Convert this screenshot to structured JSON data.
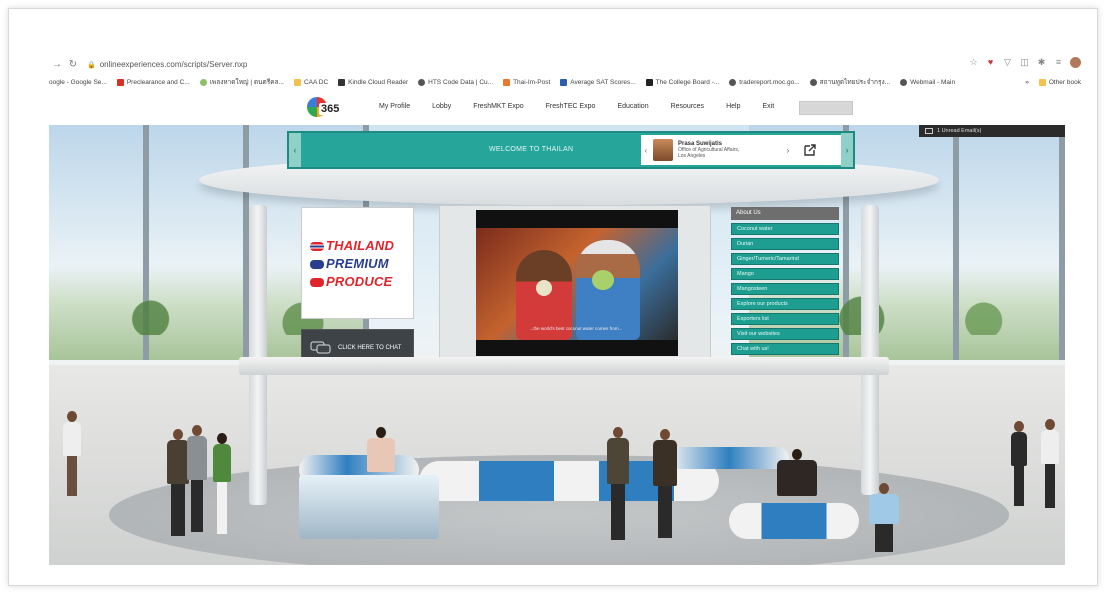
{
  "browser": {
    "url": "onlineexperiences.com/scripts/Server.nxp",
    "bookmarks": [
      "oogle - Google Se...",
      "Preclearance and C...",
      "เพลงหาดใหญ่ | ดนตรีคล...",
      "CAA DC",
      "Kindle Cloud Reader",
      "HTS Code Data | Cu...",
      "Thai-Im-Post",
      "Average SAT Scores...",
      "The College Board -...",
      "tradereport.moc.go...",
      "สถานทูตไทยประจำกรุง...",
      "Webmail - Main"
    ],
    "bookmarks_more": "»",
    "other_bookmarks": "Other book"
  },
  "site": {
    "logo_text": "365",
    "nav": [
      "My Profile",
      "Lobby",
      "FreshMKT Expo",
      "FreshTEC Expo",
      "Education",
      "Resources",
      "Help",
      "Exit"
    ],
    "search_placeholder": ""
  },
  "banner": {
    "title": "WELCOME TO THAILAN",
    "contact_name": "Prasa Suwijatis",
    "contact_line1": "Office of Agricultural Affairs,",
    "contact_line2": "Los Angeles"
  },
  "mail": {
    "label": "1 Unread Email(s)"
  },
  "brand": {
    "line1": "THAILAND",
    "line2": "PREMIUM",
    "line3": "PRODUCE"
  },
  "chat": {
    "label": "CLICK HERE TO CHAT"
  },
  "video": {
    "caption": "...the world's best coconut water comes from..."
  },
  "menu": {
    "heading": "About Us",
    "items": [
      "Coconut water",
      "Durian",
      "Ginger/Tumeric/Tamarind",
      "Mango",
      "Mangosteen",
      "Explore our products",
      "Exporters list",
      "Visit our websites",
      "Chat with us!"
    ]
  },
  "colors": {
    "teal": "#26a59a",
    "teal_dark": "#1e9d91",
    "thai_red": "#e0242b",
    "thai_blue": "#2a3e8f"
  }
}
